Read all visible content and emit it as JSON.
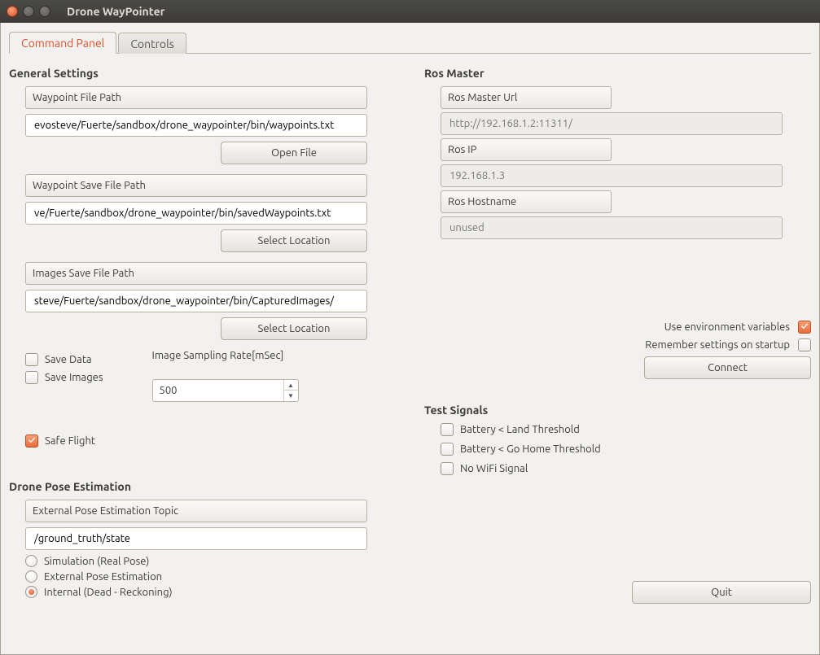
{
  "window": {
    "title": "Drone WayPointer"
  },
  "tabs": [
    {
      "label": "Command Panel",
      "active": true
    },
    {
      "label": "Controls",
      "active": false
    }
  ],
  "general": {
    "heading": "General Settings",
    "waypoint_path_label": "Waypoint File Path",
    "waypoint_path_value": "evosteve/Fuerte/sandbox/drone_waypointer/bin/waypoints.txt",
    "open_file_btn": "Open File",
    "waypoint_save_label": "Waypoint Save File Path",
    "waypoint_save_value": "ve/Fuerte/sandbox/drone_waypointer/bin/savedWaypoints.txt",
    "select_location_btn": "Select Location",
    "images_save_label": "Images Save File Path",
    "images_save_value": "steve/Fuerte/sandbox/drone_waypointer/bin/CapturedImages/",
    "save_data_label": "Save Data",
    "save_data_checked": false,
    "save_images_label": "Save Images",
    "save_images_checked": false,
    "sampling_label": "Image Sampling Rate[mSec]",
    "sampling_value": "500",
    "safe_flight_label": "Safe Flight",
    "safe_flight_checked": true
  },
  "pose": {
    "heading": "Drone Pose Estimation",
    "topic_label": "External Pose Estimation Topic",
    "topic_value": "/ground_truth/state",
    "options": {
      "sim": "Simulation (Real Pose)",
      "ext": "External Pose Estimation",
      "int": "Internal (Dead - Reckoning)"
    },
    "selected": "int"
  },
  "ros": {
    "heading": "Ros Master",
    "url_label": "Ros Master Url",
    "url_value": "http://192.168.1.2:11311/",
    "ip_label": "Ros IP",
    "ip_value": "192.168.1.3",
    "host_label": "Ros Hostname",
    "host_value": "unused",
    "use_env_label": "Use environment variables",
    "use_env_checked": true,
    "remember_label": "Remember settings on startup",
    "remember_checked": false,
    "connect_btn": "Connect"
  },
  "test": {
    "heading": "Test Signals",
    "battery_land_label": "Battery < Land Threshold",
    "battery_land_checked": false,
    "battery_home_label": "Battery < Go Home Threshold",
    "battery_home_checked": false,
    "nowifi_label": "No WiFi Signal",
    "nowifi_checked": false
  },
  "quit_btn": "Quit"
}
